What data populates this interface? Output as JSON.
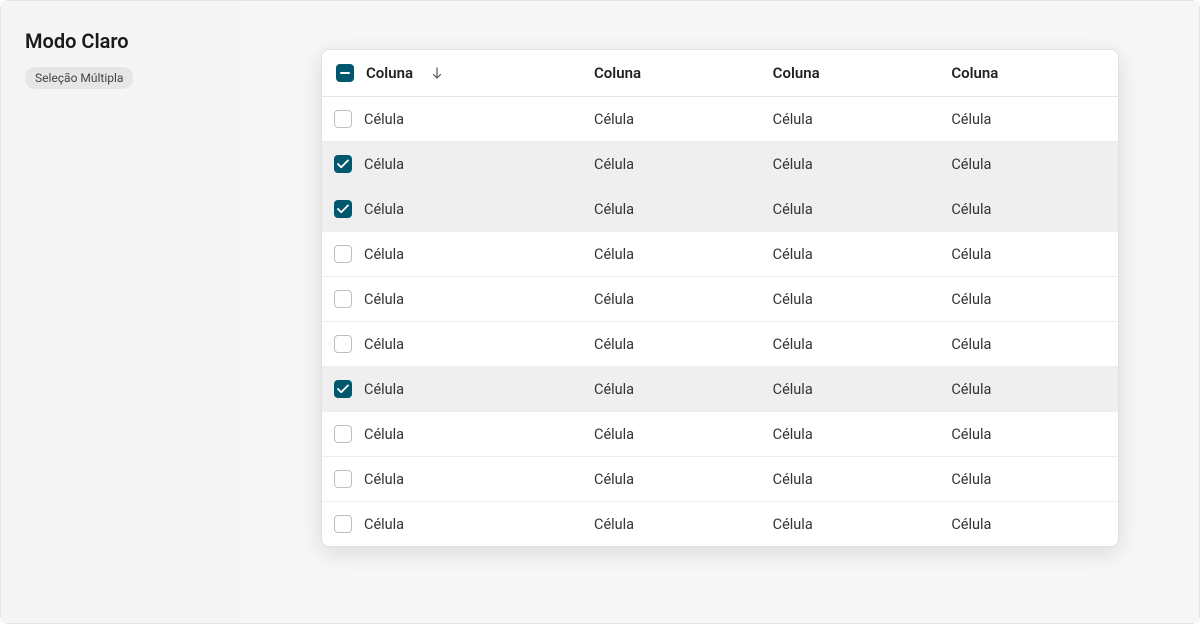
{
  "sidebar": {
    "title": "Modo Claro",
    "chip": "Seleção Múltipla"
  },
  "table": {
    "headers": [
      "Coluna",
      "Coluna",
      "Coluna",
      "Coluna"
    ],
    "rows": [
      {
        "selected": false,
        "cells": [
          "Célula",
          "Célula",
          "Célula",
          "Célula"
        ]
      },
      {
        "selected": true,
        "cells": [
          "Célula",
          "Célula",
          "Célula",
          "Célula"
        ]
      },
      {
        "selected": true,
        "cells": [
          "Célula",
          "Célula",
          "Célula",
          "Célula"
        ]
      },
      {
        "selected": false,
        "cells": [
          "Célula",
          "Célula",
          "Célula",
          "Célula"
        ]
      },
      {
        "selected": false,
        "cells": [
          "Célula",
          "Célula",
          "Célula",
          "Célula"
        ]
      },
      {
        "selected": false,
        "cells": [
          "Célula",
          "Célula",
          "Célula",
          "Célula"
        ]
      },
      {
        "selected": true,
        "cells": [
          "Célula",
          "Célula",
          "Célula",
          "Célula"
        ]
      },
      {
        "selected": false,
        "cells": [
          "Célula",
          "Célula",
          "Célula",
          "Célula"
        ]
      },
      {
        "selected": false,
        "cells": [
          "Célula",
          "Célula",
          "Célula",
          "Célula"
        ]
      },
      {
        "selected": false,
        "cells": [
          "Célula",
          "Célula",
          "Célula",
          "Célula"
        ]
      }
    ]
  }
}
